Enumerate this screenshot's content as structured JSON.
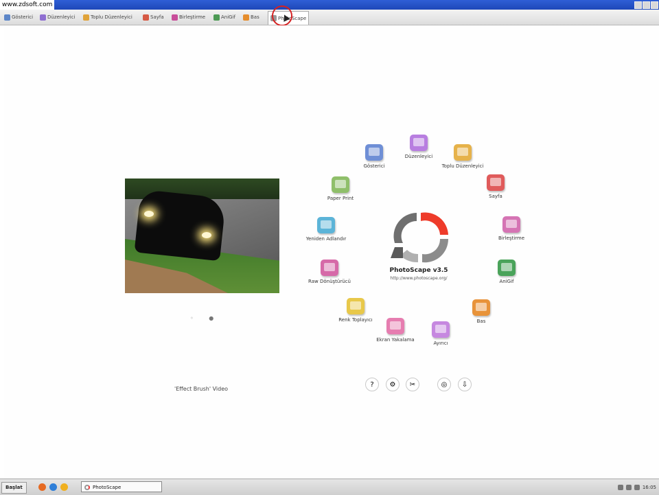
{
  "watermark": "www.zdsoft.com",
  "tabs": [
    {
      "label": "Gösterici",
      "color": "#5d86c8"
    },
    {
      "label": "Düzenleyici",
      "color": "#8f6fd1"
    },
    {
      "label": "Toplu Düzenleyici",
      "color": "#e0a33a"
    },
    {
      "label": "Sayfa",
      "color": "#d65a45"
    },
    {
      "label": "Birleştirme",
      "color": "#c84e9a"
    },
    {
      "label": "AniGif",
      "color": "#4d9a55"
    },
    {
      "label": "Bas",
      "color": "#e58d2d"
    },
    {
      "label": "PhotoScape",
      "color": "#999999"
    }
  ],
  "main": {
    "caption": "'Effect Brush' Video",
    "slideshow_dots": "◦ ●",
    "brand": "PhotoScape v3.5",
    "url": "http://www.photoscape.org/"
  },
  "menu": [
    {
      "label": "Gösterici",
      "icon": "viewer-icon",
      "color": "#6f8fd6"
    },
    {
      "label": "Düzenleyici",
      "icon": "editor-icon",
      "color": "#b87ee0"
    },
    {
      "label": "Toplu Düzenleyici",
      "icon": "batch-editor-icon",
      "color": "#e6b24a"
    },
    {
      "label": "Sayfa",
      "icon": "page-icon",
      "color": "#e05b5b"
    },
    {
      "label": "Birleştirme",
      "icon": "combine-icon",
      "color": "#d574b4"
    },
    {
      "label": "AniGif",
      "icon": "animated-gif-icon",
      "color": "#4aa35a"
    },
    {
      "label": "Bas",
      "icon": "print-icon",
      "color": "#e8933a"
    },
    {
      "label": "Ayırıcı",
      "icon": "splitter-icon",
      "color": "#c688e0"
    },
    {
      "label": "Ekran Yakalama",
      "icon": "screen-capture-icon",
      "color": "#e67db0"
    },
    {
      "label": "Renk Toplayıcı",
      "icon": "color-picker-icon",
      "color": "#e8c84a"
    },
    {
      "label": "Raw Dönüştürücü",
      "icon": "raw-converter-icon",
      "color": "#d66aa8"
    },
    {
      "label": "Yeniden Adlandır",
      "icon": "rename-icon",
      "color": "#5cb4d8"
    },
    {
      "label": "Paper Print",
      "icon": "paper-print-icon",
      "color": "#8fbf6a"
    }
  ],
  "tools": [
    {
      "icon": "help-icon",
      "glyph": "?"
    },
    {
      "icon": "settings-icon",
      "glyph": "⚙"
    },
    {
      "icon": "tools-icon",
      "glyph": "✂"
    },
    {
      "icon": "world-icon",
      "glyph": "◎"
    },
    {
      "icon": "download-icon",
      "glyph": "⇩"
    }
  ],
  "taskbar": {
    "start_label": "Başlat",
    "task": "PhotoScape",
    "clock": "16:05"
  }
}
